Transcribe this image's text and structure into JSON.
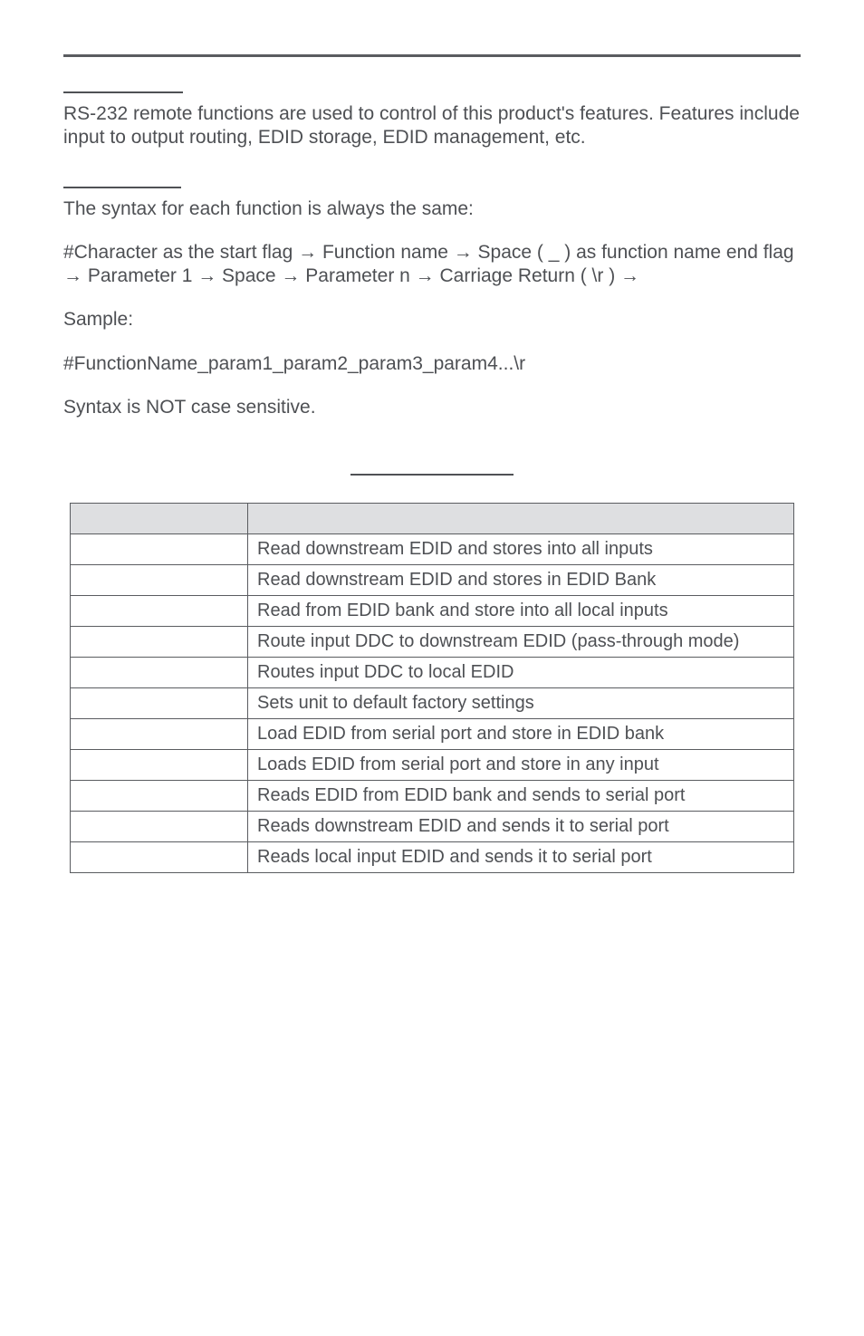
{
  "intro": {
    "para1": "RS-232 remote functions are used to control of this product's features. Features include input to output routing, EDID storage, EDID management, etc."
  },
  "syntax": {
    "line1": "The syntax for each function is always the same:",
    "line2": "#Character as the start flag → Function name → Space ( _ ) as function name end flag → Parameter 1 → Space → Parameter n → Carriage Return ( \\r ) →",
    "sample_label": "Sample:",
    "sample_code": "#FunctionName_param1_param2_param3_param4...\\r",
    "note": "Syntax is NOT case sensitive."
  },
  "table": {
    "header": {
      "col1": "",
      "col2": ""
    },
    "rows": [
      {
        "cmd": "",
        "desc": "Read downstream EDID and stores into all inputs"
      },
      {
        "cmd": "",
        "desc": "Read downstream EDID and stores in EDID Bank"
      },
      {
        "cmd": "",
        "desc": "Read from EDID bank and store into all local inputs"
      },
      {
        "cmd": "",
        "desc": "Route input DDC to downstream EDID (pass-through mode)"
      },
      {
        "cmd": "",
        "desc": "Routes input DDC to local EDID"
      },
      {
        "cmd": "",
        "desc": "Sets unit to default factory settings"
      },
      {
        "cmd": "",
        "desc": "Load EDID from serial port and store in EDID bank"
      },
      {
        "cmd": "",
        "desc": "Loads EDID from serial port and store in any input"
      },
      {
        "cmd": "",
        "desc": "Reads EDID from EDID bank and sends to serial port"
      },
      {
        "cmd": "",
        "desc": "Reads downstream EDID and sends it to serial port"
      },
      {
        "cmd": "",
        "desc": "Reads local input EDID and sends it to serial port"
      }
    ]
  }
}
